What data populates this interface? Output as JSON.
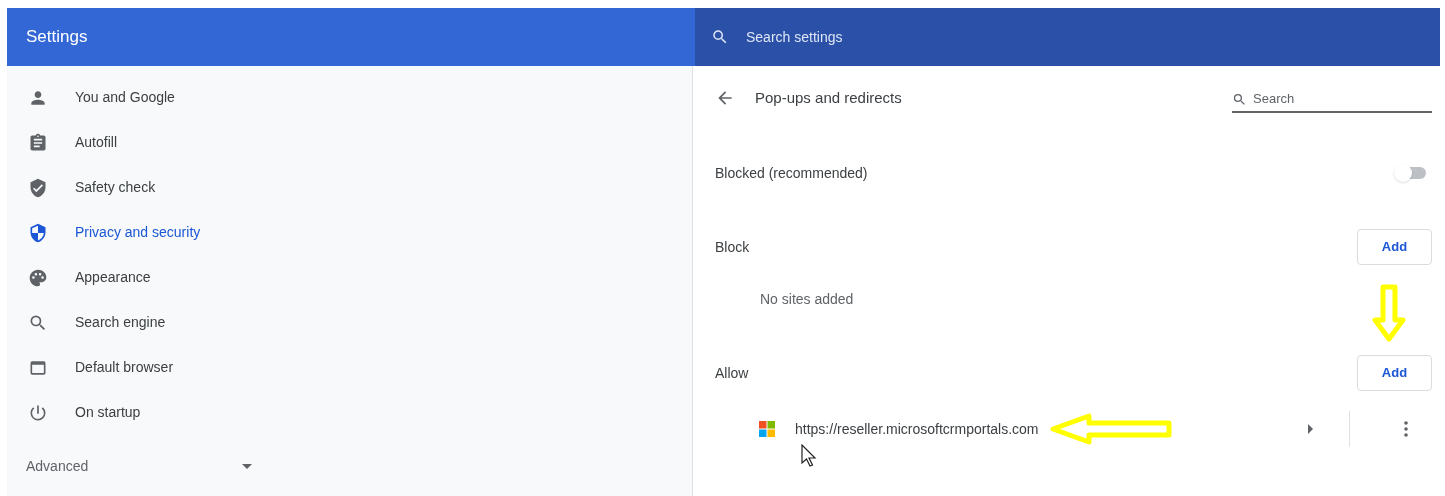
{
  "header": {
    "title": "Settings",
    "search": {
      "placeholder": "Search settings"
    }
  },
  "sidebar": {
    "items": [
      {
        "label": "You and Google",
        "selected": false
      },
      {
        "label": "Autofill",
        "selected": false
      },
      {
        "label": "Safety check",
        "selected": false
      },
      {
        "label": "Privacy and security",
        "selected": true
      },
      {
        "label": "Appearance",
        "selected": false
      },
      {
        "label": "Search engine",
        "selected": false
      },
      {
        "label": "Default browser",
        "selected": false
      },
      {
        "label": "On startup",
        "selected": false
      }
    ],
    "advanced": {
      "label": "Advanced",
      "expanded": false
    }
  },
  "page": {
    "title": "Pop-ups and redirects",
    "search": {
      "placeholder": "Search"
    },
    "blocked": {
      "label": "Blocked (recommended)",
      "on": false
    },
    "block": {
      "heading": "Block",
      "button": "Add",
      "empty": "No sites added"
    },
    "allow": {
      "heading": "Allow",
      "button": "Add",
      "sites": [
        {
          "url": "https://reseller.microsoftcrmportals.com"
        }
      ]
    }
  }
}
